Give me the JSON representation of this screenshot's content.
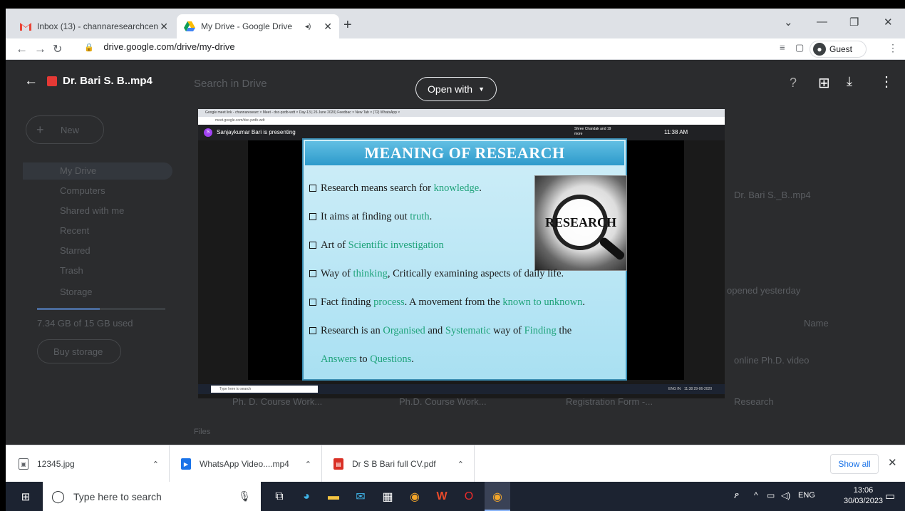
{
  "browser": {
    "tabs": [
      {
        "title": "Inbox (13) - channaresearchcente",
        "icon": "gmail-icon",
        "color": "#ea4335"
      },
      {
        "title": "My Drive - Google Drive",
        "icon": "drive-icon",
        "color": "#fbbc04"
      }
    ],
    "new_tab": "+",
    "url": "drive.google.com/drive/my-drive",
    "profile": "Guest"
  },
  "drive": {
    "file_name": "Dr. Bari S. B..mp4",
    "open_with": "Open with",
    "search_placeholder": "Search in Drive",
    "new_label": "New",
    "sidebar": [
      "My Drive",
      "Computers",
      "Shared with me",
      "Recent",
      "Starred",
      "Trash",
      "Storage"
    ],
    "storage_used": "7.34 GB of 15 GB used",
    "buy_storage": "Buy storage",
    "card_title": "Dr. Bari S._B..mp4",
    "card_sub": "opened yesterday",
    "sort_label": "Name",
    "right_items": [
      "online Ph.D. video",
      "Research"
    ],
    "bottom_items": [
      "Ph. D. Course Work...",
      "Ph.D. Course Work...",
      "Registration Form -..."
    ],
    "files_label": "Files"
  },
  "video": {
    "meet_tabs": "Google meet link - channaresearc  ×   Meet - dsc-pzdb-wdt  ×   Day-13 | 26 June 2020) Feedbac  ×   New Tab  ×   (72) WhatsApp  ×",
    "meet_url": "meet.google.com/dsc-pzdb-wdt",
    "presenter": "Sanjaykumar Bari is presenting",
    "participants": "Shree Chandak and 19 more",
    "meet_time": "11:38 AM",
    "slide": {
      "title": "MEANING OF RESEARCH",
      "image_word": "RESEARCH",
      "bullets": [
        {
          "plain": "Research means search for ",
          "hl": "knowledge",
          "end": "."
        },
        {
          "plain": "It aims at finding out ",
          "hl": "truth",
          "end": "."
        },
        {
          "plain": "Art of ",
          "hl": "Scientific investigation",
          "end": ""
        },
        {
          "plain": "Way of ",
          "hl": "thinking",
          "end": ", Critically examining aspects of daily life."
        },
        {
          "plain": "Fact finding ",
          "hl": "process",
          "end": ". A movement from the ",
          "hl2": "known to unknown",
          "end2": "."
        },
        {
          "plain": "Research is an ",
          "hl": "Organised",
          "end": " and ",
          "hl2": "Systematic",
          "end2": " way of ",
          "hl3": "Finding",
          "end3": " the"
        }
      ],
      "last_line_hl": "Answers",
      "last_line_mid": " to ",
      "last_line_hl2": "Questions",
      "last_line_end": "."
    },
    "inner_search": "Type here to search",
    "inner_clock": "11:38  29-06-2020",
    "inner_lang": "ENG IN"
  },
  "downloads": [
    {
      "name": "12345.jpg",
      "icon": "image-file-icon",
      "color": "#5f6368"
    },
    {
      "name": "WhatsApp Video....mp4",
      "icon": "video-file-icon",
      "color": "#1a73e8"
    },
    {
      "name": "Dr S B Bari full CV.pdf",
      "icon": "pdf-file-icon",
      "color": "#d93025"
    }
  ],
  "show_all": "Show all",
  "taskbar": {
    "search_placeholder": "Type here to search",
    "lang": "ENG",
    "time": "13:06",
    "date": "30/03/2023"
  }
}
